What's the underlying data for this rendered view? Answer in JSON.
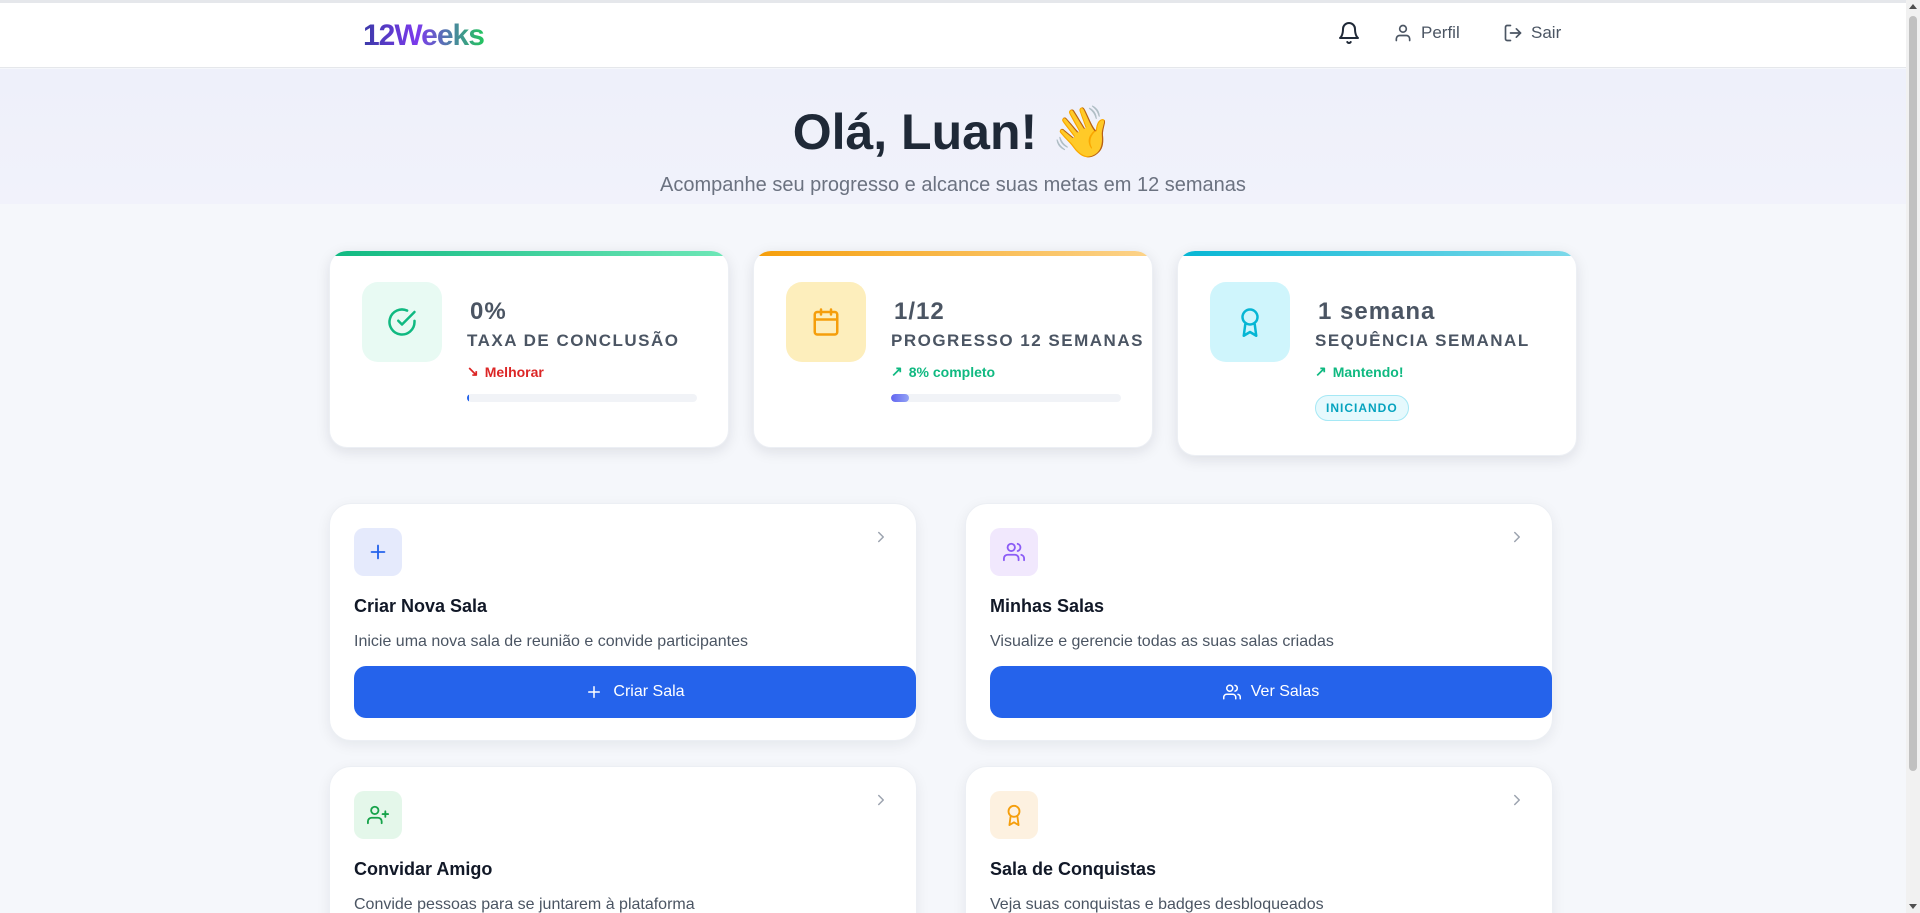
{
  "nav": {
    "logo": "12Weeks",
    "profile_label": "Perfil",
    "logout_label": "Sair"
  },
  "hero": {
    "title": "Olá, Luan! 👋",
    "subtitle": "Acompanhe seu progresso e alcance suas metas em 12 semanas"
  },
  "stats": [
    {
      "value": "0%",
      "label": "TAXA DE CONCLUSÃO",
      "trend_icon": "↘",
      "trend": "Melhorar",
      "progress": 0.01,
      "accent": "#10b981",
      "icon": "check-circle-icon"
    },
    {
      "value": "1/12",
      "label": "PROGRESSO 12 SEMANAS",
      "trend_icon": "↗",
      "trend": "8% completo",
      "progress": 0.08,
      "accent": "#f59e0b",
      "icon": "calendar-icon"
    },
    {
      "value": "1 semana",
      "label": "SEQUÊNCIA SEMANAL",
      "trend_icon": "↗",
      "trend": "Mantendo!",
      "badge": "INICIANDO",
      "accent": "#06b6d4",
      "icon": "award-icon"
    }
  ],
  "actions": [
    {
      "title": "Criar Nova Sala",
      "description": "Inicie uma nova sala de reunião e convide participantes",
      "button": "Criar Sala",
      "icon": "plus-icon"
    },
    {
      "title": "Minhas Salas",
      "description": "Visualize e gerencie todas as suas salas criadas",
      "button": "Ver Salas",
      "icon": "users-icon"
    },
    {
      "title": "Convidar Amigo",
      "description": "Convide pessoas para se juntarem à plataforma",
      "icon": "user-plus-icon"
    },
    {
      "title": "Sala de Conquistas",
      "description": "Veja suas conquistas e badges desbloqueados",
      "icon": "award-icon"
    }
  ],
  "colors": {
    "primary": "#2563eb",
    "success": "#10b981",
    "warning": "#f59e0b",
    "info": "#06b6d4",
    "danger": "#dc2626"
  }
}
